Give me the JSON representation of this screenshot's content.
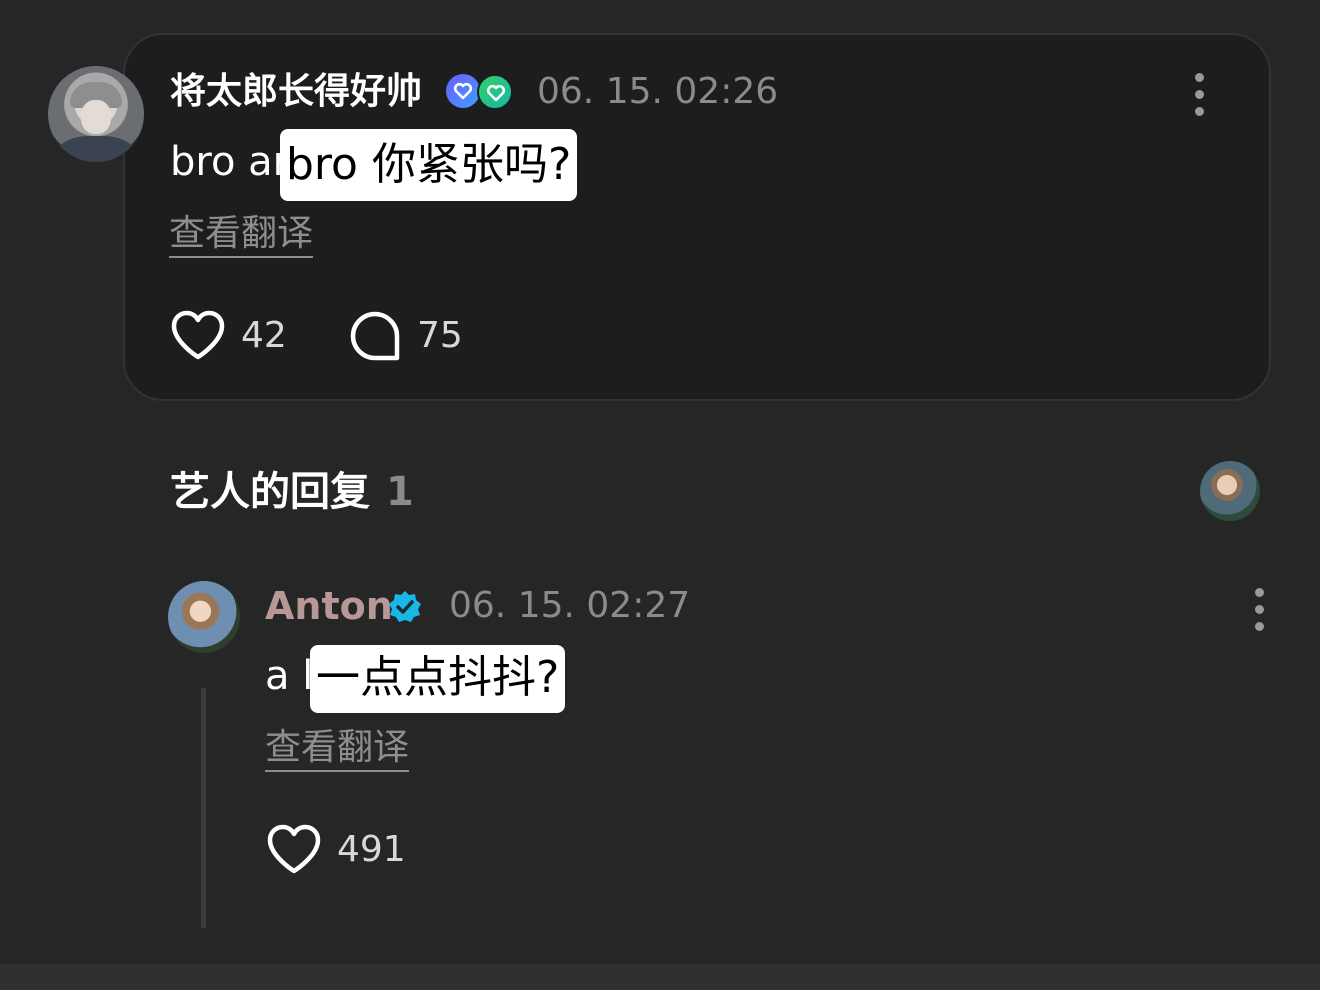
{
  "comment": {
    "username": "将太郎长得好帅",
    "timestamp": "06. 15. 02:26",
    "text_visible": "bro ar",
    "translation_overlay": "bro 你紧张吗?",
    "see_translation": "查看翻译",
    "likes": "42",
    "comments": "75",
    "badges": [
      "heart-badge-blue",
      "heart-badge-green"
    ]
  },
  "artist_replies": {
    "title": "艺人的回复",
    "count": "1"
  },
  "reply": {
    "username": "Anton",
    "verified": true,
    "timestamp": "06. 15. 02:27",
    "text_visible": "a l",
    "translation_overlay": "一点点抖抖?",
    "see_translation": "查看翻译",
    "likes": "491"
  },
  "colors": {
    "background": "#262626",
    "card": "#1d1d1d",
    "anton_name": "#b89896",
    "verified": "#19b6e6",
    "muted_text": "#8b8b8b"
  },
  "icons": {
    "more": "more-vertical-icon",
    "like": "heart-icon",
    "comment": "comment-bubble-icon",
    "verified": "verified-check-icon"
  }
}
